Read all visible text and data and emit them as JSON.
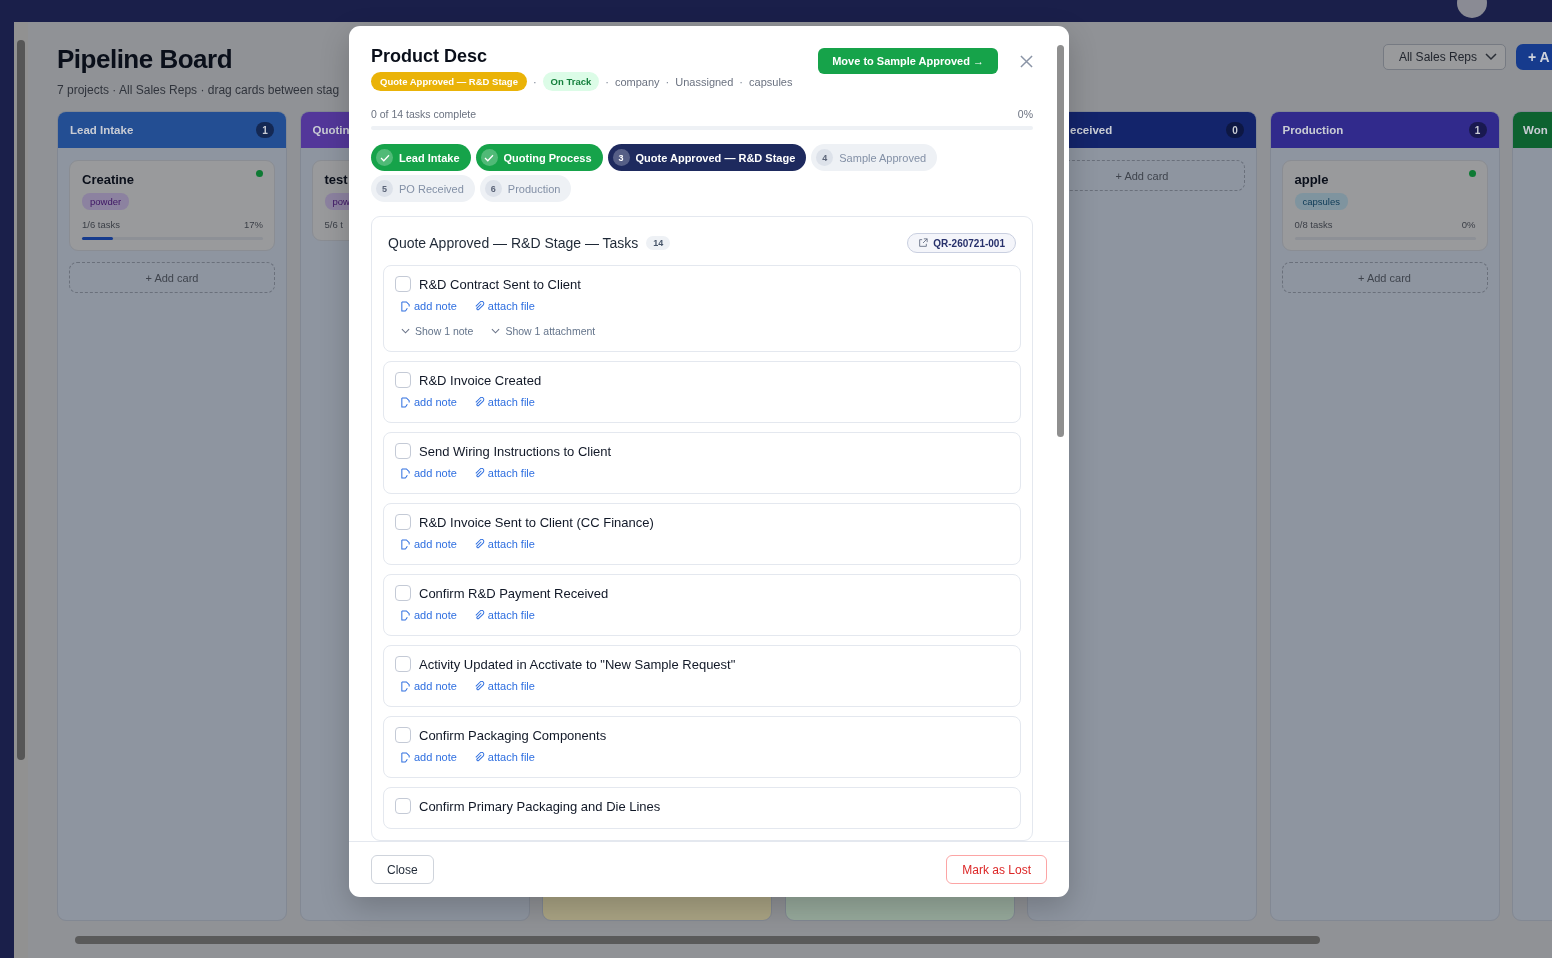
{
  "header": {
    "title": "Pipeline Board",
    "subtitle": "7 projects · All Sales Reps · drag cards between stag",
    "filter": "All Sales Reps",
    "add_button": "+ A"
  },
  "columns": [
    {
      "title": "Lead Intake",
      "count": "1",
      "color": "#234e93",
      "cards": [
        {
          "title": "Creatine",
          "tag": "powder",
          "progress": "1/6 tasks",
          "percent": "17%",
          "level": 0.17,
          "dot": true
        }
      ],
      "add": "+ Add card"
    },
    {
      "title": "Quotin",
      "color": "#53379a",
      "cards": [
        {
          "title": "test",
          "tag": "pow",
          "progress": "5/6 t"
        }
      ]
    },
    {
      "color": "#aaa484"
    },
    {
      "color": "#97aa9c"
    },
    {
      "title": "eceived",
      "count": "0",
      "color": "#13246b",
      "add": "+ Add card"
    },
    {
      "title": "Production",
      "count": "1",
      "color": "#312a8c",
      "cards": [
        {
          "title": "apple",
          "tag": "capsules",
          "progress": "0/8 tasks",
          "percent": "0%",
          "level": 0,
          "dot": true
        }
      ],
      "add": "+ Add card"
    },
    {
      "title": "Won",
      "color": "#0d6230"
    }
  ],
  "modal": {
    "title": "Product Desc",
    "meta": [
      {
        "kind": "stage_badge",
        "text": "Quote Approved — R&D Stage"
      },
      {
        "kind": "separator",
        "text": "·"
      },
      {
        "kind": "status_badge",
        "text": "On Track"
      },
      {
        "kind": "separator",
        "text": "·"
      },
      {
        "kind": "text",
        "text": "company"
      },
      {
        "kind": "separator",
        "text": "·"
      },
      {
        "kind": "text",
        "text": "Unassigned"
      },
      {
        "kind": "separator",
        "text": "·"
      },
      {
        "kind": "text",
        "text": "capsules"
      }
    ],
    "move_button": "Move to Sample Approved →",
    "progress_text": "0 of 14 tasks complete",
    "progress_percent": "0%",
    "level": 0,
    "stages": [
      {
        "label": "Lead Intake",
        "done": true,
        "selected": false
      },
      {
        "label": "Quoting Process",
        "done": true,
        "selected": false
      },
      {
        "number": "3",
        "label": "Quote Approved — R&D Stage",
        "done": false,
        "selected": true
      },
      {
        "number": "4",
        "label": "Sample Approved",
        "done": false,
        "selected": false
      },
      {
        "number": "5",
        "label": "PO Received",
        "done": false,
        "selected": false
      },
      {
        "number": "6",
        "label": "Production",
        "done": false,
        "selected": false
      }
    ],
    "tasks_title": "Quote Approved — R&D Stage — Tasks",
    "tasks_count": "14",
    "reference": "QR-260721-001",
    "tasks": [
      {
        "title": "R&D Contract Sent to Client",
        "checked": false,
        "actions": [
          "add note",
          "attach file"
        ],
        "toggles": [
          "Show 1 note",
          "Show 1 attachment"
        ]
      },
      {
        "title": "R&D Invoice Created",
        "checked": false,
        "actions": [
          "add note",
          "attach file"
        ]
      },
      {
        "title": "Send Wiring Instructions to Client",
        "checked": false,
        "actions": [
          "add note",
          "attach file"
        ]
      },
      {
        "title": "R&D Invoice Sent to Client (CC Finance)",
        "checked": false,
        "actions": [
          "add note",
          "attach file"
        ]
      },
      {
        "title": "Confirm R&D Payment Received",
        "checked": false,
        "actions": [
          "add note",
          "attach file"
        ]
      },
      {
        "title": "Activity Updated in Acctivate to \"New Sample Request\"",
        "checked": false,
        "actions": [
          "add note",
          "attach file"
        ]
      },
      {
        "title": "Confirm Packaging Components",
        "checked": false,
        "actions": [
          "add note",
          "attach file"
        ]
      },
      {
        "title": "Confirm Primary Packaging and Die Lines",
        "checked": false
      }
    ],
    "close_button": "Close",
    "lost_button": "Mark as Lost"
  }
}
